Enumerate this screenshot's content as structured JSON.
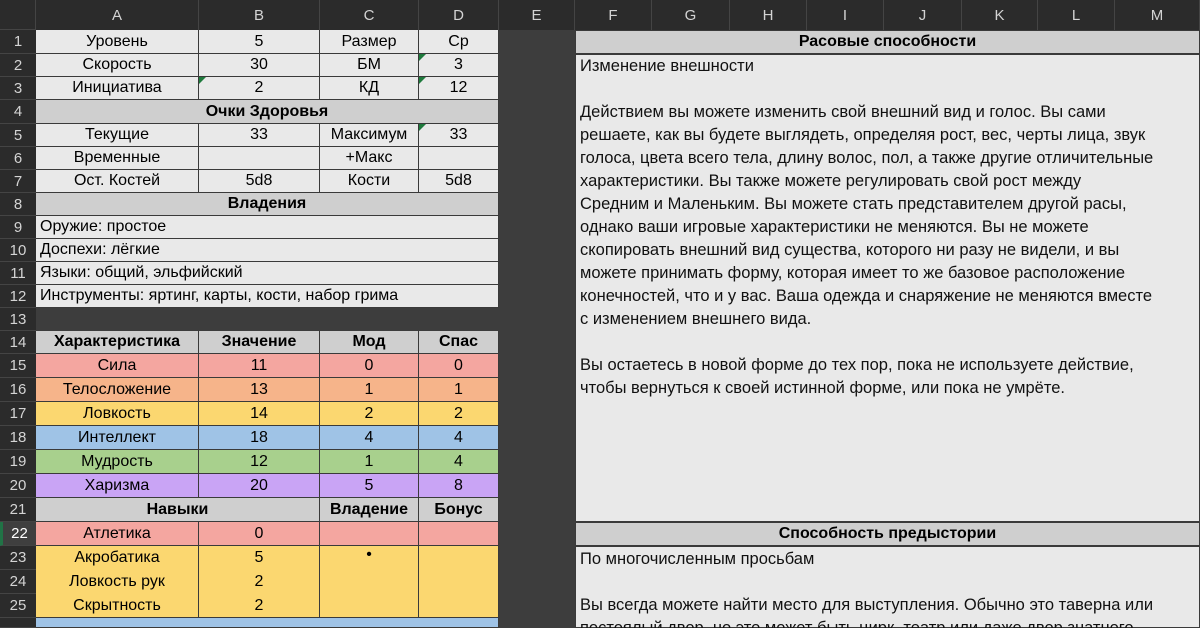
{
  "columns": [
    "A",
    "B",
    "C",
    "D",
    "E",
    "F",
    "G",
    "H",
    "I",
    "J",
    "K",
    "L",
    "M"
  ],
  "rows": [
    "1",
    "2",
    "3",
    "4",
    "5",
    "6",
    "7",
    "8",
    "9",
    "10",
    "11",
    "12",
    "13",
    "14",
    "15",
    "16",
    "17",
    "18",
    "19",
    "20",
    "21",
    "22",
    "23",
    "24",
    "25"
  ],
  "basic": {
    "r1": {
      "a": "Уровень",
      "b": "5",
      "c": "Размер",
      "d": "Ср"
    },
    "r2": {
      "a": "Скорость",
      "b": "30",
      "c": "БМ",
      "d": "3"
    },
    "r3": {
      "a": "Инициатива",
      "b": "2",
      "c": "КД",
      "d": "12"
    }
  },
  "hp": {
    "title": "Очки Здоровья",
    "r5": {
      "a": "Текущие",
      "b": "33",
      "c": "Максимум",
      "d": "33"
    },
    "r6": {
      "a": "Временные",
      "b": "",
      "c": "+Макс",
      "d": ""
    },
    "r7": {
      "a": "Ост. Костей",
      "b": "5d8",
      "c": "Кости",
      "d": "5d8"
    }
  },
  "prof": {
    "title": "Владения",
    "weapons": "Оружие: простое",
    "armor": "Доспехи: лёгкие",
    "languages": "Языки: общий, эльфийский",
    "tools": "Инструменты: яртинг, карты, кости, набор грима"
  },
  "abilities": {
    "headers": {
      "name": "Характеристика",
      "value": "Значение",
      "mod": "Мод",
      "save": "Спас"
    },
    "rows": [
      {
        "name": "Сила",
        "value": "11",
        "mod": "0",
        "save": "0",
        "color": "#f4a6a0"
      },
      {
        "name": "Телосложение",
        "value": "13",
        "mod": "1",
        "save": "1",
        "color": "#f6b48a"
      },
      {
        "name": "Ловкость",
        "value": "14",
        "mod": "2",
        "save": "2",
        "color": "#fbd770"
      },
      {
        "name": "Интеллект",
        "value": "18",
        "mod": "4",
        "save": "4",
        "color": "#9fc3e6"
      },
      {
        "name": "Мудрость",
        "value": "12",
        "mod": "1",
        "save": "4",
        "color": "#a8d08d"
      },
      {
        "name": "Харизма",
        "value": "20",
        "mod": "5",
        "save": "8",
        "color": "#c9a4f5"
      }
    ]
  },
  "skills": {
    "headers": {
      "name": "Навыки",
      "prof": "Владение",
      "bonus": "Бонус"
    },
    "rows": [
      {
        "name": "Атлетика",
        "value": "0",
        "prof": "",
        "bonus": "",
        "color": "#f4a6a0"
      },
      {
        "name": "Акробатика",
        "value": "5",
        "prof": "•",
        "bonus": "",
        "color": "#fbd770"
      },
      {
        "name": "Ловкость рук",
        "value": "2",
        "prof": "",
        "bonus": "",
        "color": "#fbd770"
      },
      {
        "name": "Скрытность",
        "value": "2",
        "prof": "",
        "bonus": "",
        "color": "#fbd770"
      }
    ]
  },
  "racial": {
    "title": "Расовые способности",
    "text": "Изменение внешности\n\nДействием вы можете изменить свой внешний вид и голос. Вы сами\nрешаете, как вы будете выглядеть, определяя рост, вес, черты лица, звук\nголоса, цвета всего тела, длину волос, пол, а также другие отличительные\nхарактеристики. Вы также можете регулировать свой рост между\nСредним и Маленьким. Вы можете стать представителем другой расы,\nоднако ваши игровые характеристики не меняются. Вы не можете\nскопировать внешний вид существа, которого ни разу не видели, и вы\nможете принимать форму, которая имеет то же базовое расположение\nконечностей, что и у вас. Ваша одежда и снаряжение не меняются вместе\nс изменением внешнего вида.\n\nВы остаетесь в новой форме до тех пор, пока не используете действие,\nчтобы вернуться к своей истинной форме, или пока не умрёте."
  },
  "background": {
    "title": "Способность предыстории",
    "text": "По многочисленным просьбам\n\nВы всегда можете найти место для выступления. Обычно это таверна или\nпостоялый двор, но это может быть цирк, театр или даже двор знатного"
  }
}
